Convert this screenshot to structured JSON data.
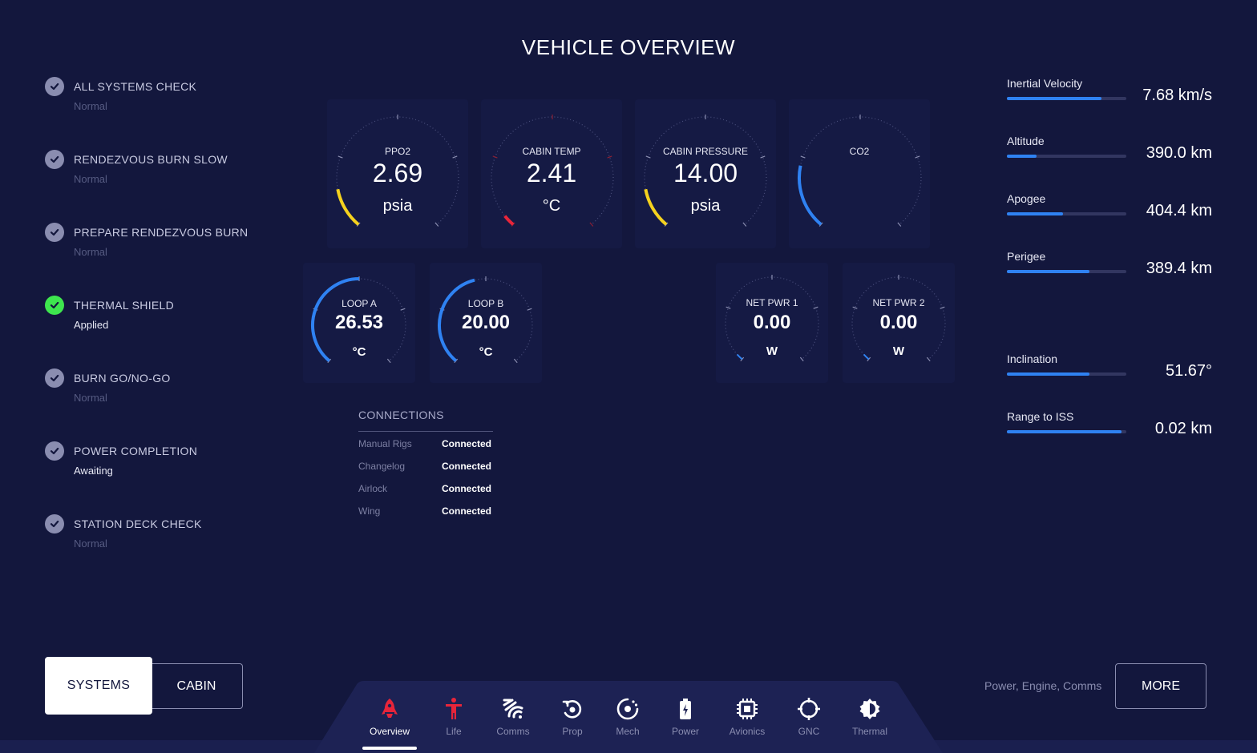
{
  "page": {
    "title": "VEHICLE OVERVIEW"
  },
  "checklist": [
    {
      "label": "ALL SYSTEMS CHECK",
      "status": "Normal",
      "state": "done"
    },
    {
      "label": "RENDEZVOUS BURN SLOW",
      "status": "Normal",
      "state": "done"
    },
    {
      "label": "PREPARE RENDEZVOUS BURN",
      "status": "Normal",
      "state": "done"
    },
    {
      "label": "THERMAL SHIELD",
      "status": "Applied",
      "state": "active"
    },
    {
      "label": "BURN GO/NO-GO",
      "status": "Normal",
      "state": "done"
    },
    {
      "label": "POWER COMPLETION",
      "status": "Awaiting",
      "state": "pending"
    },
    {
      "label": "STATION DECK CHECK",
      "status": "Normal",
      "state": "done"
    }
  ],
  "gauges": {
    "ppo2": {
      "label": "PPO2",
      "value": "2.69",
      "unit": "psia",
      "color": "#f5d21e",
      "level": 0.14
    },
    "cabin_temp": {
      "label": "CABIN TEMP",
      "value": "2.41",
      "unit": "°C",
      "color": "#e8253a",
      "level": 0.04
    },
    "cabin_pressure": {
      "label": "CABIN PRESSURE",
      "value": "14.00",
      "unit": "psia",
      "color": "#f5d21e",
      "level": 0.14
    },
    "co2": {
      "label": "CO2",
      "value": "",
      "unit": "",
      "color": "#2f82f2",
      "level": 0.22
    },
    "loop_a": {
      "label": "LOOP A",
      "value": "26.53",
      "unit": "°C",
      "color": "#2f82f2",
      "level": 0.5
    },
    "loop_b": {
      "label": "LOOP B",
      "value": "20.00",
      "unit": "°C",
      "color": "#2f82f2",
      "level": 0.45
    },
    "net_pwr_1": {
      "label": "NET PWR 1",
      "value": "0.00",
      "unit": "W",
      "color": "#2f82f2",
      "level": 0.03
    },
    "net_pwr_2": {
      "label": "NET PWR 2",
      "value": "0.00",
      "unit": "W",
      "color": "#2f82f2",
      "level": 0.03
    }
  },
  "connections": {
    "title": "CONNECTIONS",
    "rows": [
      {
        "name": "Manual Rigs",
        "state": "Connected"
      },
      {
        "name": "Changelog",
        "state": "Connected"
      },
      {
        "name": "Airlock",
        "state": "Connected"
      },
      {
        "name": "Wing",
        "state": "Connected"
      }
    ]
  },
  "telemetry": [
    {
      "label": "Inertial Velocity",
      "value": "7.68 km/s",
      "level": 0.79
    },
    {
      "label": "Altitude",
      "value": "390.0 km",
      "level": 0.25
    },
    {
      "label": "Apogee",
      "value": "404.4 km",
      "level": 0.47
    },
    {
      "label": "Perigee",
      "value": "389.4 km",
      "level": 0.69
    },
    {
      "label": "Inclination",
      "value": "51.67°",
      "level": 0.69
    },
    {
      "label": "Range to ISS",
      "value": "0.02 km",
      "level": 0.96
    }
  ],
  "mode_buttons": {
    "systems": "SYSTEMS",
    "cabin": "CABIN",
    "active": "SYSTEMS"
  },
  "more": {
    "caption": "Power, Engine, Comms",
    "label": "MORE"
  },
  "nav": [
    {
      "label": "Overview",
      "icon": "rocket-icon",
      "active": true
    },
    {
      "label": "Life",
      "icon": "person-icon",
      "active": false
    },
    {
      "label": "Comms",
      "icon": "signal-icon",
      "active": false
    },
    {
      "label": "Prop",
      "icon": "propulsion-icon",
      "active": false
    },
    {
      "label": "Mech",
      "icon": "mech-icon",
      "active": false
    },
    {
      "label": "Power",
      "icon": "battery-icon",
      "active": false
    },
    {
      "label": "Avionics",
      "icon": "chip-icon",
      "active": false
    },
    {
      "label": "GNC",
      "icon": "crosshair-icon",
      "active": false
    },
    {
      "label": "Thermal",
      "icon": "thermal-icon",
      "active": false
    }
  ],
  "colors": {
    "background": "#13173d",
    "accent": "#2f82f2",
    "warning": "#f5d21e",
    "alert": "#e8253a",
    "ok": "#3ee64e"
  }
}
